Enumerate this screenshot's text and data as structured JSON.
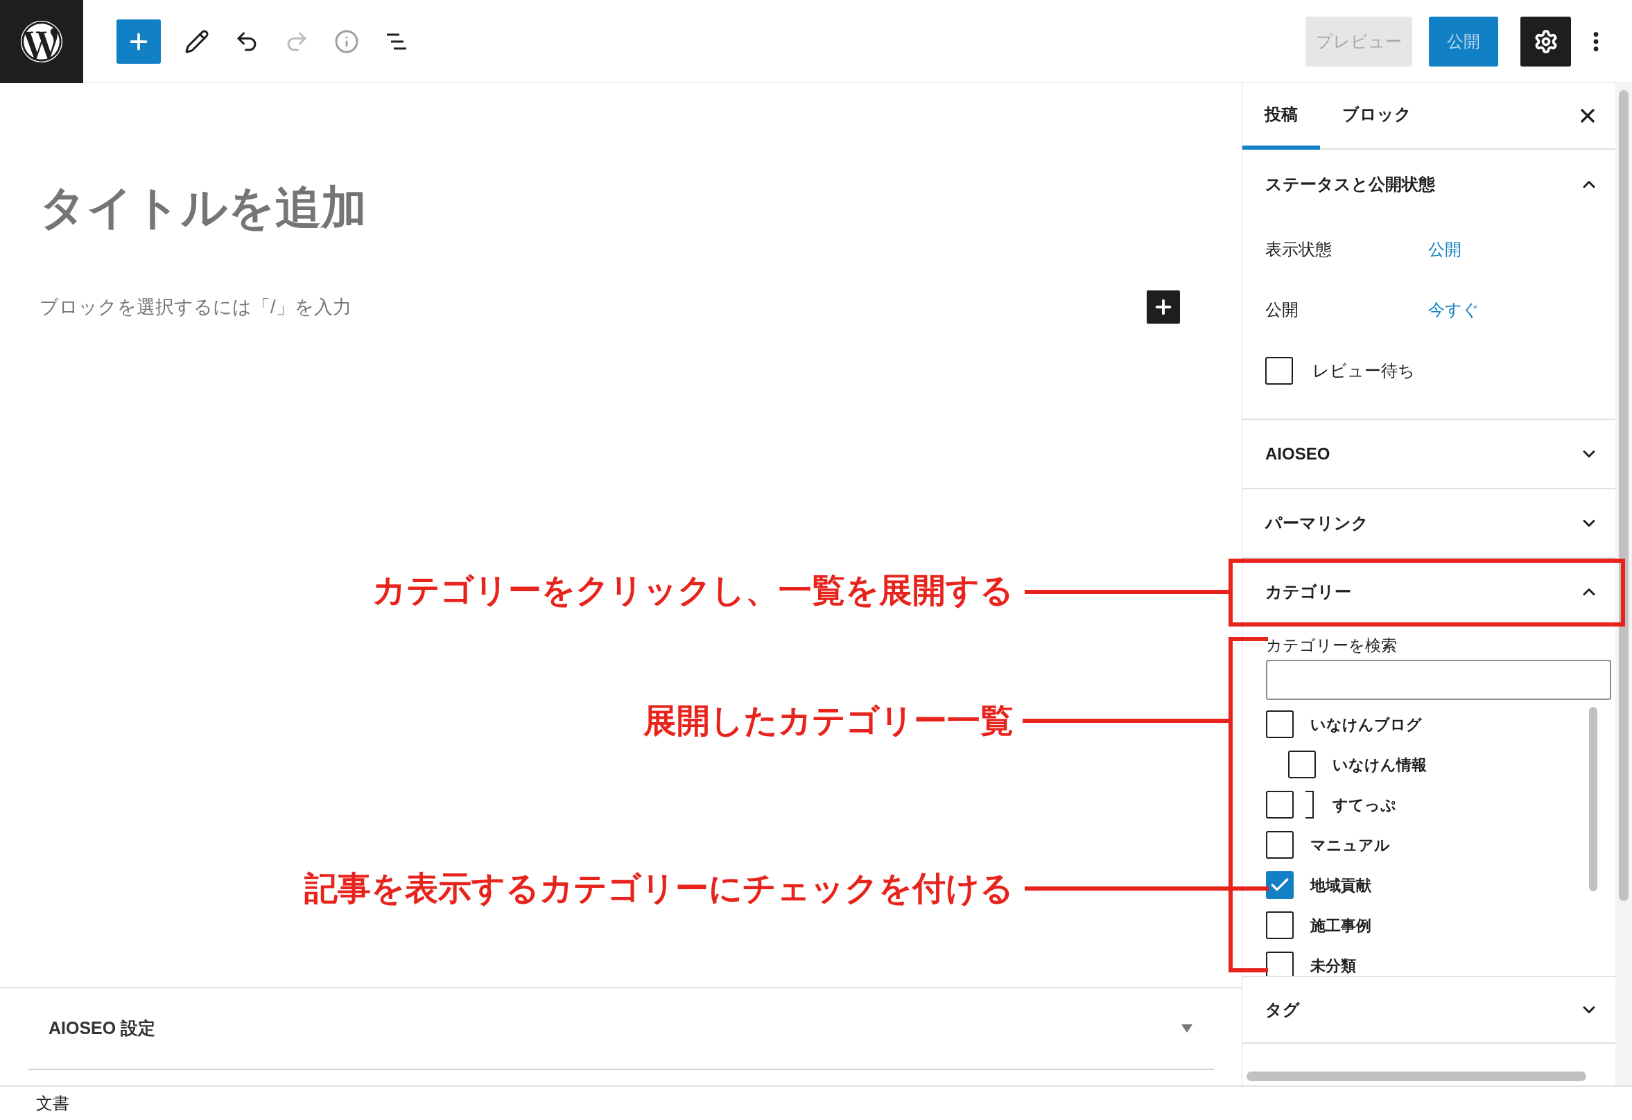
{
  "toolbar": {
    "redo_disabled": true,
    "preview_button": "プレビュー",
    "publish_button": "公開",
    "settings_active": true
  },
  "editor": {
    "title_placeholder": "タイトルを追加",
    "block_prompt": "ブロックを選択するには「/」を入力"
  },
  "metabox": {
    "title": "AIOSEO 設定",
    "expanded": false
  },
  "sidebar": {
    "tabs": [
      {
        "label": "投稿",
        "selected": true
      },
      {
        "label": "ブロック",
        "selected": false
      }
    ],
    "status_panel": {
      "title": "ステータスと公開状態",
      "expanded": true,
      "rows": [
        {
          "label": "表示状態",
          "value": "公開"
        },
        {
          "label": "公開",
          "value": "今すぐ"
        }
      ],
      "review": {
        "label": "レビュー待ち",
        "checked": false
      }
    },
    "panels": [
      {
        "title": "AIOSEO",
        "expanded": false
      },
      {
        "title": "パーマリンク",
        "expanded": false
      }
    ],
    "category_panel": {
      "title": "カテゴリー",
      "expanded": true,
      "search_label": "カテゴリーを検索",
      "categories": [
        {
          "label": "いなけんブログ",
          "checked": false,
          "kind": "plain",
          "children": [
            {
              "label": "いなけん情報",
              "checked": false,
              "kind": "plain"
            }
          ]
        },
        {
          "label": "すてっぷ",
          "checked": false,
          "kind": "overlapped"
        },
        {
          "label": "マニュアル",
          "checked": false,
          "kind": "plain"
        },
        {
          "label": "地域貢献",
          "checked": true,
          "kind": "plain"
        },
        {
          "label": "施工事例",
          "checked": false,
          "kind": "plain"
        },
        {
          "label": "未分類",
          "checked": false,
          "kind": "plain"
        }
      ]
    },
    "tag_panel": {
      "title": "タグ",
      "expanded": false
    }
  },
  "status_bar": "文書",
  "annotations": [
    {
      "text": "カテゴリーをクリックし、一覧を展開する"
    },
    {
      "text": "展開したカテゴリー一覧"
    },
    {
      "text": "記事を表示するカテゴリーにチェックを付ける"
    }
  ]
}
